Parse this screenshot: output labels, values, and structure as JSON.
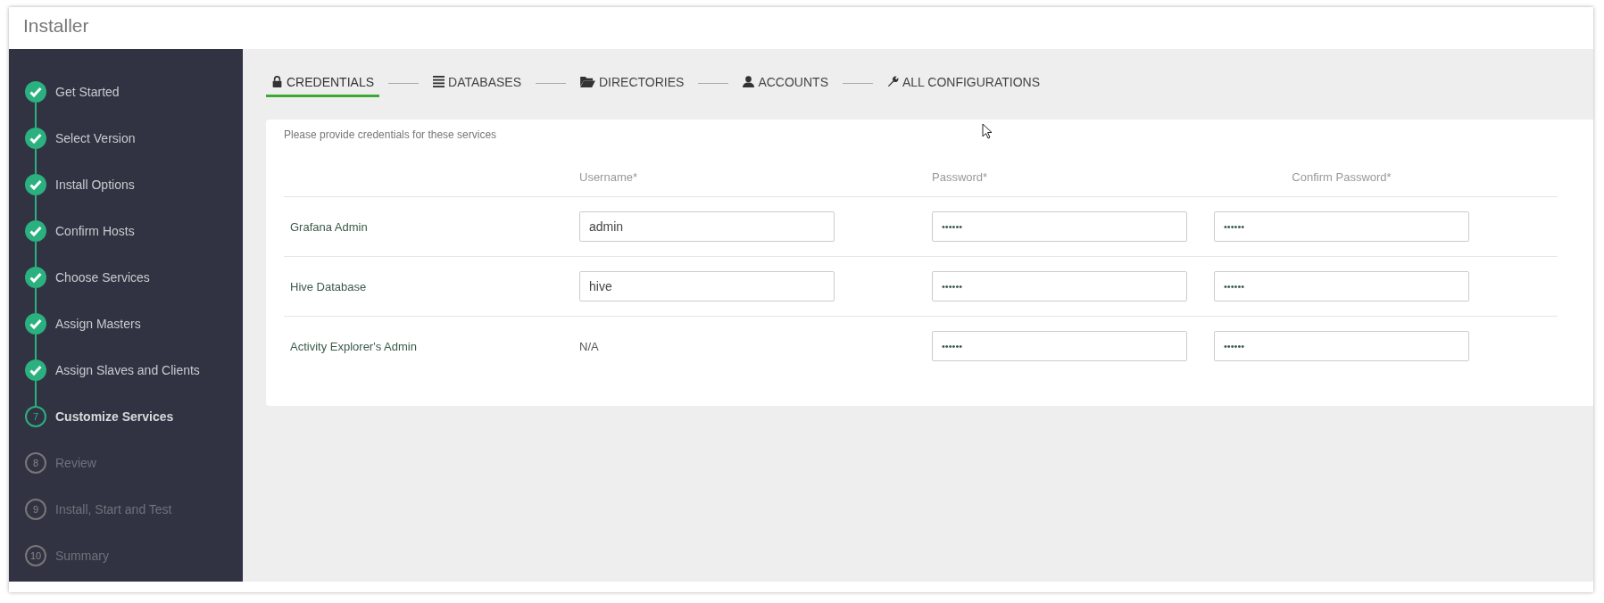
{
  "window": {
    "title": "Installer"
  },
  "steps": [
    {
      "label": "Get Started",
      "completed": true
    },
    {
      "label": "Select Version",
      "completed": true
    },
    {
      "label": "Install Options",
      "completed": true
    },
    {
      "label": "Confirm Hosts",
      "completed": true
    },
    {
      "label": "Choose Services",
      "completed": true
    },
    {
      "label": "Assign Masters",
      "completed": true
    },
    {
      "label": "Assign Slaves and Clients",
      "completed": true
    },
    {
      "number": "7",
      "label": "Customize Services",
      "completed": false,
      "current": true
    },
    {
      "number": "8",
      "label": "Review",
      "completed": false,
      "current": false
    },
    {
      "number": "9",
      "label": "Install, Start and Test",
      "completed": false,
      "current": false
    },
    {
      "number": "10",
      "label": "Summary",
      "completed": false,
      "current": false
    }
  ],
  "tabs": [
    {
      "label": "CREDENTIALS",
      "selected": true
    },
    {
      "label": "DATABASES",
      "selected": false
    },
    {
      "label": "DIRECTORIES",
      "selected": false
    },
    {
      "label": "ACCOUNTS",
      "selected": false
    },
    {
      "label": "ALL CONFIGURATIONS",
      "selected": false
    }
  ],
  "credentials": {
    "intro": "Please provide credentials for these services",
    "columns": [
      "Username*",
      "Password*",
      "Confirm Password*"
    ],
    "rows": [
      {
        "service": "Grafana Admin",
        "username": {
          "kind": "field",
          "value": "admin"
        },
        "password": "••••••",
        "confirm_password": "••••••"
      },
      {
        "service": "Hive Database",
        "username": {
          "kind": "field",
          "value": "hive"
        },
        "password": "••••••",
        "confirm_password": "••••••"
      },
      {
        "service": "Activity Explorer's Admin",
        "username": {
          "kind": "text",
          "value": "N/A"
        },
        "password": "••••••",
        "confirm_password": "••••••"
      }
    ]
  }
}
